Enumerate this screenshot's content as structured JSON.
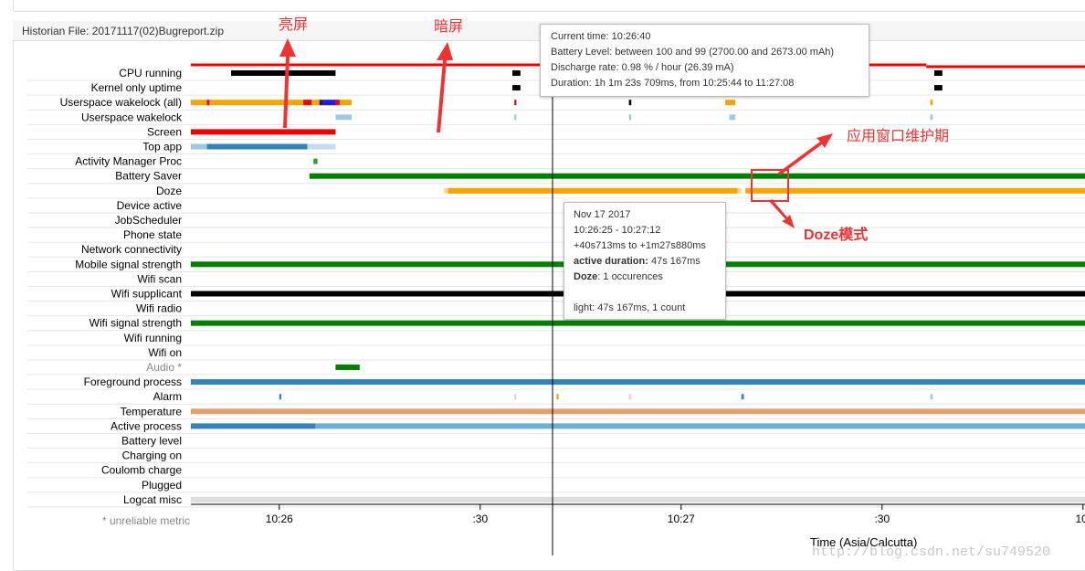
{
  "panel": {
    "title": "Historian File: 20171117(02)Bugreport.zip"
  },
  "rows": [
    {
      "label": "CPU running",
      "segments": [
        [
          10.0,
          36.0,
          "#000"
        ],
        [
          80.0,
          82.0,
          "#000"
        ],
        [
          128.0,
          131.0,
          "#eee"
        ],
        [
          185.0,
          187.0,
          "#000"
        ]
      ]
    },
    {
      "label": "Kernel only uptime",
      "segments": [
        [
          80.0,
          82.0,
          "#000"
        ],
        [
          185.0,
          187.0,
          "#000"
        ]
      ]
    },
    {
      "label": "Userspace wakelock (all)",
      "segments": [
        [
          0.0,
          40.0,
          "#f5a400"
        ],
        [
          4.0,
          4.6,
          "#e00"
        ],
        [
          28.0,
          30.0,
          "#e00"
        ],
        [
          32.0,
          33.0,
          "#1a1a80"
        ],
        [
          33.0,
          36.0,
          "#1a1aee"
        ],
        [
          36.0,
          37.0,
          "#e00"
        ],
        [
          80.5,
          81.0,
          "#e00"
        ],
        [
          109.0,
          109.6,
          "#000"
        ],
        [
          133.0,
          135.5,
          "#f5a400"
        ],
        [
          184.0,
          184.6,
          "#f5a400"
        ]
      ]
    },
    {
      "label": "Userspace wakelock",
      "segments": [
        [
          36.0,
          40.0,
          "#9ecae1"
        ],
        [
          80.5,
          81.0,
          "#9ecae1"
        ],
        [
          109.0,
          109.6,
          "#9ecae1"
        ],
        [
          134.0,
          135.5,
          "#9ecae1"
        ],
        [
          184.0,
          184.6,
          "#9ecae1"
        ]
      ]
    },
    {
      "label": "Screen",
      "segments": [
        [
          0.0,
          36.0,
          "#e00"
        ]
      ]
    },
    {
      "label": "Top app",
      "segments": [
        [
          0.0,
          4.0,
          "#9ecae1"
        ],
        [
          4.0,
          29.0,
          "#3182bd"
        ],
        [
          29.0,
          36.0,
          "#c6dbef"
        ]
      ]
    },
    {
      "label": "Activity Manager Proc",
      "segments": [
        [
          30.5,
          31.5,
          "#2ca02c"
        ]
      ]
    },
    {
      "label": "Battery Saver",
      "segments": [
        [
          29.5,
          223.0,
          "#008000"
        ]
      ]
    },
    {
      "label": "Doze",
      "segments": [
        [
          63.0,
          137.0,
          "#fcd29a"
        ],
        [
          64.0,
          136.0,
          "#f5a400"
        ],
        [
          138.0,
          223.0,
          "#f5a400"
        ]
      ]
    },
    {
      "label": "Device active",
      "segments": []
    },
    {
      "label": "JobScheduler",
      "segments": []
    },
    {
      "label": "Phone state",
      "segments": []
    },
    {
      "label": "Network connectivity",
      "segments": []
    },
    {
      "label": "Mobile signal strength",
      "segments": [
        [
          0.0,
          223.0,
          "#008000"
        ]
      ]
    },
    {
      "label": "Wifi scan",
      "segments": []
    },
    {
      "label": "Wifi supplicant",
      "segments": [
        [
          0.0,
          223.0,
          "#000"
        ]
      ]
    },
    {
      "label": "Wifi radio",
      "segments": []
    },
    {
      "label": "Wifi signal strength",
      "segments": [
        [
          0.0,
          223.0,
          "#008000"
        ]
      ]
    },
    {
      "label": "Wifi running",
      "segments": []
    },
    {
      "label": "Wifi on",
      "segments": []
    },
    {
      "label": "Audio *",
      "grey": true,
      "segments": [
        [
          36.0,
          42.0,
          "#008000"
        ]
      ]
    },
    {
      "label": "Foreground process",
      "segments": [
        [
          0.0,
          223.0,
          "#3182bd"
        ]
      ]
    },
    {
      "label": "Alarm",
      "segments": [
        [
          22.0,
          22.5,
          "#3182bd"
        ],
        [
          80.5,
          81.0,
          "#c6dbef"
        ],
        [
          91.0,
          91.5,
          "#f5a400"
        ],
        [
          109.0,
          109.6,
          "#fcc"
        ],
        [
          137.0,
          137.6,
          "#3182bd"
        ],
        [
          184.0,
          184.6,
          "#9ecae1"
        ]
      ]
    },
    {
      "label": "Temperature",
      "segments": [
        [
          0.0,
          223.0,
          "#e0a070"
        ]
      ]
    },
    {
      "label": "Active process",
      "segments": [
        [
          0.0,
          31.0,
          "#3182bd"
        ],
        [
          31.0,
          223.0,
          "#6baed6"
        ]
      ]
    },
    {
      "label": "Battery level",
      "segments": []
    },
    {
      "label": "Charging on",
      "segments": []
    },
    {
      "label": "Coulomb charge",
      "segments": []
    },
    {
      "label": "Plugged",
      "segments": []
    },
    {
      "label": "Logcat misc",
      "segments": [
        [
          0.0,
          223.0,
          "#ddd"
        ]
      ]
    }
  ],
  "battery_line": {
    "color": "#e00",
    "from": 0.0,
    "to": 223.0,
    "drop_at": 183.0
  },
  "unreliable_note": "* unreliable metric",
  "x_axis": {
    "title": "Time (Asia/Calcutta)",
    "ticks": [
      {
        "label": "10:26",
        "t": 22.0
      },
      {
        "label": ":30",
        "t": 72.0
      },
      {
        "label": "10:27",
        "t": 122.0
      },
      {
        "label": ":30",
        "t": 172.0
      },
      {
        "label": "10:",
        "t": 222.0
      }
    ]
  },
  "cursor_t": 90.0,
  "tooltip_time": {
    "current_time": "Current time: 10:26:40",
    "battery_level": "Battery Level: between 100 and 99 (2700.00 and 2673.00 mAh)",
    "discharge_rate": "Discharge rate: 0.98 % / hour (26.39 mA)",
    "duration": "Duration: 1h 1m 23s 709ms, from 10:25:44 to 11:27:08"
  },
  "tooltip_doze": {
    "date": "Nov 17 2017",
    "range": "10:26:25 - 10:27:12",
    "offsets": "+40s713ms to +1m27s880ms",
    "active_label": "active duration:",
    "active_value": " 47s 167ms",
    "doze_label": "Doze",
    "doze_value": ": 1 occurences",
    "light": "light: 47s 167ms, 1 count"
  },
  "annotations": {
    "screen_on": "亮屏",
    "screen_off": "暗屏",
    "maintenance_window": "应用窗口维护期",
    "doze_mode": "Doze模式"
  },
  "watermark": "http://blog.csdn.net/su749520"
}
